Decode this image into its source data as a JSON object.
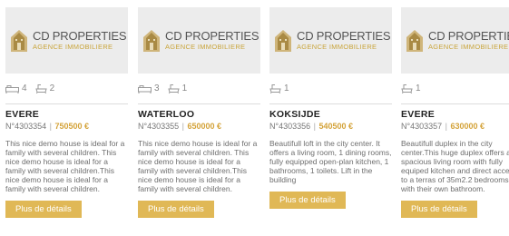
{
  "brand": {
    "name": "CD PROPERTIES",
    "tagline": "AGENCE IMMOBILIERE"
  },
  "colors": {
    "accent": "#e0b856",
    "price": "#d4a33a",
    "thumbnail_bg": "#ececec"
  },
  "cards": [
    {
      "city": "EVERE",
      "ref": "N°4303354",
      "price": "750500 €",
      "bedrooms": "4",
      "bathrooms": "2",
      "description": "This nice demo house is ideal for a family with several children. This nice demo house is ideal for a family with several children.This nice demo house is ideal for a family with several children.",
      "button": "Plus de détails"
    },
    {
      "city": "WATERLOO",
      "ref": "N°4303355",
      "price": "650000 €",
      "bedrooms": "3",
      "bathrooms": "1",
      "description": "This nice demo house is ideal for a family with several children. This nice demo house is ideal for a family with several children.This nice demo house is ideal for a family with several children.",
      "button": "Plus de détails"
    },
    {
      "city": "KOKSIJDE",
      "ref": "N°4303356",
      "price": "540500 €",
      "bedrooms": "",
      "bathrooms": "1",
      "description": "Beautifull loft in the city center. It offers a living room, 1 dining rooms, fully equipped open-plan kitchen, 1 bathrooms, 1 toilets. Lift in the building",
      "button": "Plus de détails"
    },
    {
      "city": "EVERE",
      "ref": "N°4303357",
      "price": "630000 €",
      "bedrooms": "",
      "bathrooms": "1",
      "description": "Beautifull duplex in the city center.This huge duplex offers a spacious living room with fully equiped kitchen and direct access to a terras of 35m2.2 bedrooms with their own bathroom.",
      "button": "Plus de détails"
    }
  ]
}
